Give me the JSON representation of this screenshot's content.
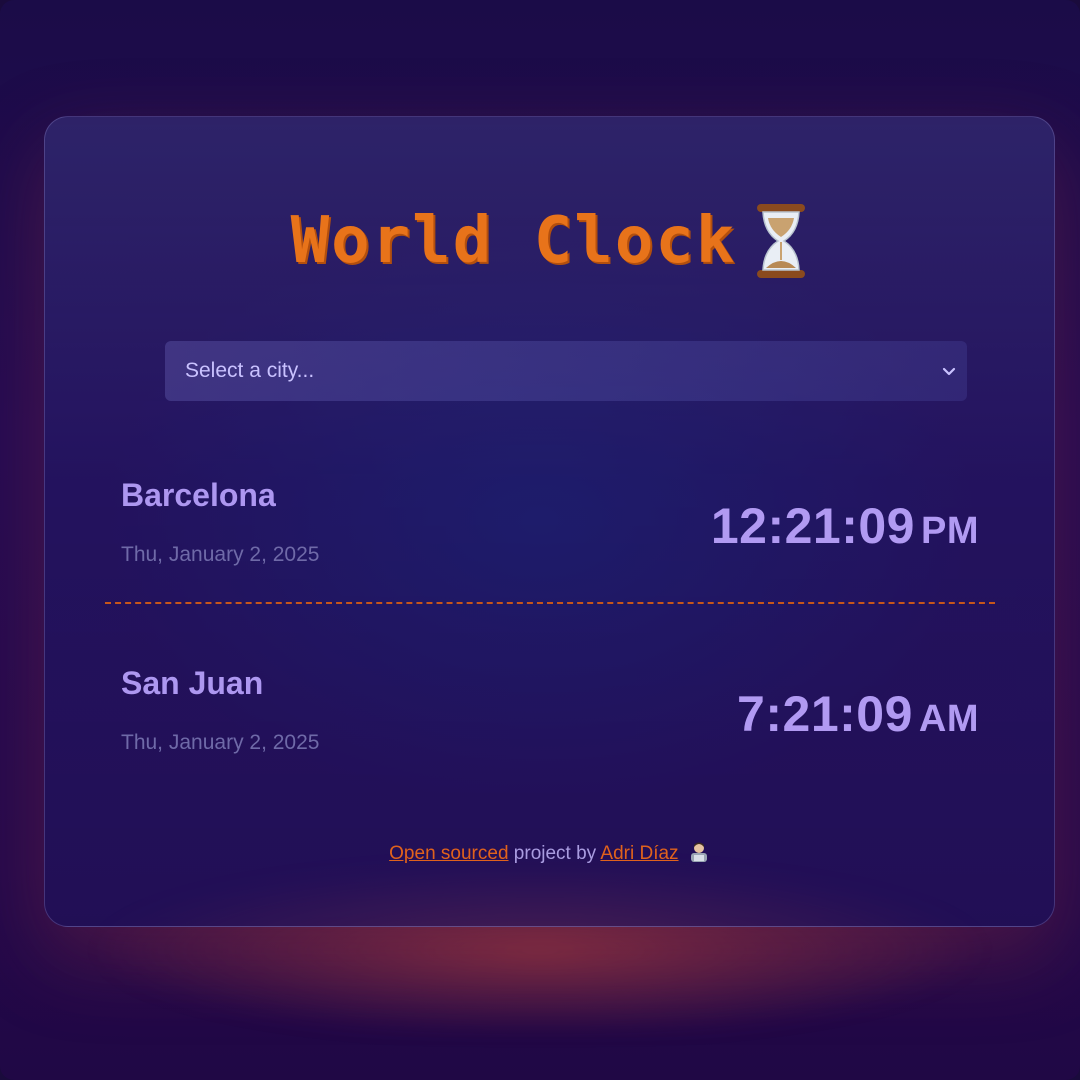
{
  "app": {
    "title": "World Clock",
    "title_icon": "hourglass-icon"
  },
  "city_select": {
    "placeholder": "Select a city...",
    "icon": "chevron-down-icon"
  },
  "clocks": [
    {
      "city": "Barcelona",
      "date": "Thu, January 2, 2025",
      "time": "12:21:09",
      "period": "PM"
    },
    {
      "city": "San Juan",
      "date": "Thu, January 2, 2025",
      "time": "7:21:09",
      "period": "AM"
    }
  ],
  "footer": {
    "link1": "Open sourced",
    "middle": "project by",
    "link2": "Adri Díaz",
    "icon": "technologist-icon"
  },
  "colors": {
    "accent": "#e8731a",
    "city_text": "#ad97f0",
    "divider": "#c7561a"
  }
}
